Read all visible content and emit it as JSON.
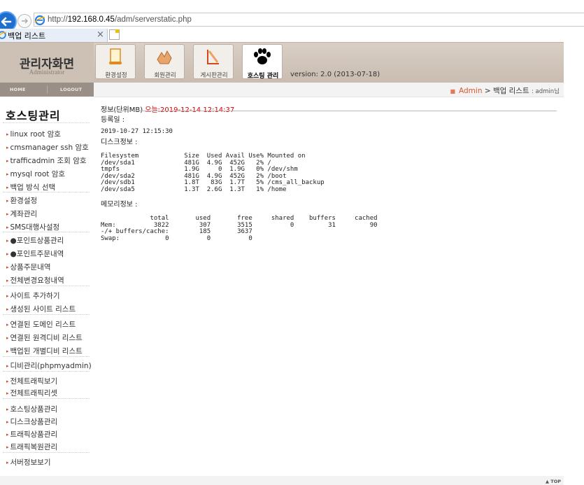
{
  "browser": {
    "url_prefix": "http://",
    "url_host": "192.168.0.45",
    "url_path": "/adm/serverstatic.php",
    "tab_title": "백업 리스트",
    "tab_close": "×"
  },
  "header": {
    "brand_title": "관리자화면",
    "brand_subtitle": "Administrator",
    "menu": [
      {
        "label": "환경설정",
        "icon": "document-icon"
      },
      {
        "label": "회원관리",
        "icon": "members-icon"
      },
      {
        "label": "게시판관리",
        "icon": "board-icon"
      },
      {
        "label": "호스팅 관리",
        "icon": "paw-icon"
      }
    ],
    "version": "version: 2.0 (2013-07-18)"
  },
  "sidebar": {
    "home": "HOME",
    "logout": "LOGOUT",
    "title": "호스팅관리",
    "items": [
      "linux root 암호",
      "cmsmanager ssh 암호",
      "trafficadmin 조회 암호",
      "mysql root 암호",
      "백업 방식 선택",
      "환경설정",
      "계좌관리",
      "SMS대행사설정",
      "●포인트상품관리",
      "●포인트주문내역",
      "상품주문내역",
      "전체변경요청내역",
      "사이트 추가하기",
      "생성된 사이트 리스트",
      "연결된 도메인 리스트",
      "연결된 원격디비 리스트",
      "백업된 개별디비 리스트",
      "디비관리(phpmyadmin)",
      "전체트래픽보기",
      "전체트래픽리셋",
      "호스팅상품관리",
      "디스크상품관리",
      "트래픽상품관리",
      "트래픽복원관리",
      "서버정보보기"
    ]
  },
  "breadcrumb": {
    "root": "Admin",
    "separator": ">",
    "current": "백업 리스트",
    "user": ": admin님"
  },
  "content": {
    "info_label": "정보(단위MB)",
    "today": "오늘:2019-12-14 12:14:37",
    "registered": "등록일 :",
    "timestamp": "2019-10-27 12:15:30",
    "disk_label": "디스크정보 :",
    "disk_output": "Filesystem            Size  Used Avail Use% Mounted on\n/dev/sda1             481G  4.9G  452G   2% /\ntmpfs                 1.9G     0  1.9G   0% /dev/shm\n/dev/sda2             481G  4.9G  452G   2% /boot\n/dev/sdb1             1.8T   83G  1.7T   5% /cms_all_backup\n/dev/sda5             1.3T  2.6G  1.3T   1% /home",
    "mem_label": "메모리정보 :",
    "mem_output": "             total       used       free     shared    buffers     cached\nMem:          3822        307       3515          0         31         90\n-/+ buffers/cache:        185       3637\nSwap:            0          0          0"
  },
  "footer": {
    "top": "▲ TOP"
  }
}
